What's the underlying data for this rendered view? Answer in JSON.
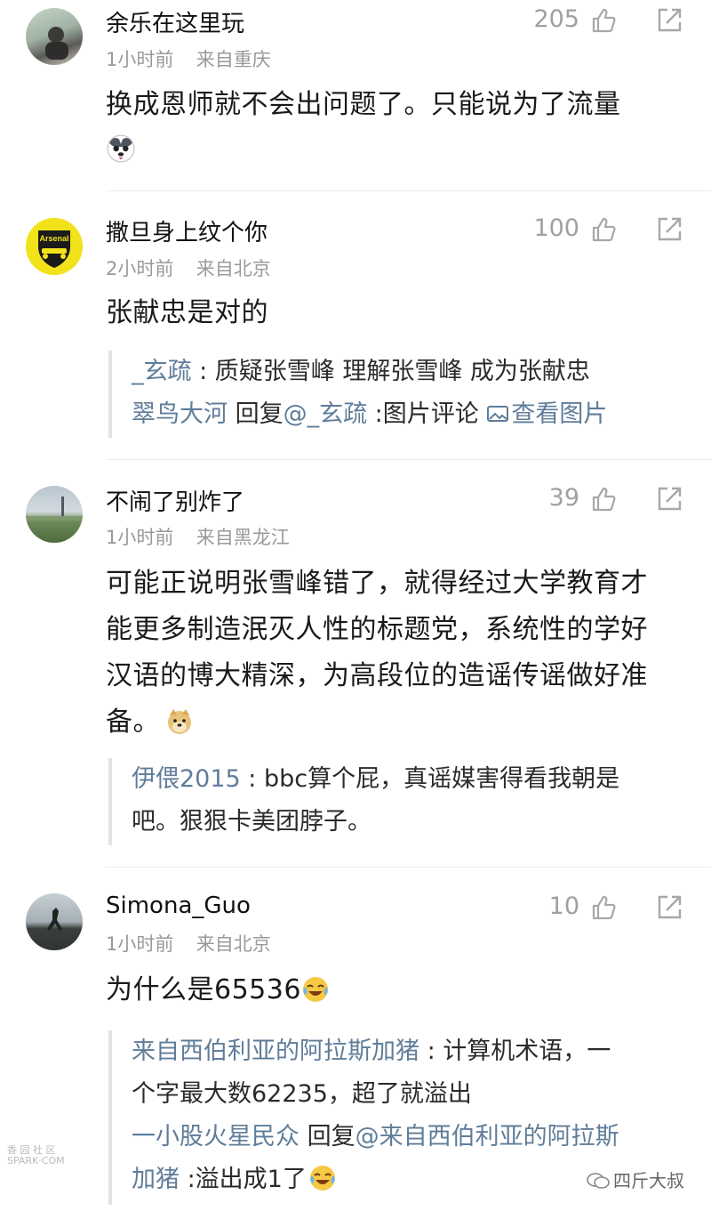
{
  "comments": [
    {
      "username": "余乐在这里玩",
      "time": "1小时前",
      "location": "来自重庆",
      "likes": "205",
      "text": "换成恩师就不会出问题了。只能说为了流量"
    },
    {
      "username": "撒旦身上纹个你",
      "avatar_label": "Arsenal",
      "time": "2小时前",
      "location": "来自北京",
      "likes": "100",
      "text": "张献忠是对的",
      "replies": [
        {
          "author": "_玄疏",
          "sep": " : ",
          "text": "质疑张雪峰 理解张雪峰 成为张献忠"
        },
        {
          "author": "翠鸟大河",
          "middle": " 回复",
          "mention": "@_玄疏",
          "text": " :图片评论 ",
          "link": "查看图片"
        }
      ]
    },
    {
      "username": "不闹了别炸了",
      "time": "1小时前",
      "location": "来自黑龙江",
      "likes": "39",
      "text_lines": [
        "可能正说明张雪峰错了，就得经过大学教育才",
        "能更多制造泯灭人性的标题党，系统性的学好",
        "汉语的博大精深，为高段位的造谣传谣做好准",
        "备。"
      ],
      "replies": [
        {
          "author": "伊偎2015",
          "sep": " : ",
          "text": "bbc算个屁，真谣媒害得看我朝是",
          "text2": "吧。狠狠卡美团脖子。"
        }
      ]
    },
    {
      "username": "Simona_Guo",
      "time": "1小时前",
      "location": "来自北京",
      "likes": "10",
      "text": "为什么是65536",
      "replies": [
        {
          "author": "来自西伯利亚的阿拉斯加猪",
          "sep": " : ",
          "text": "计算机术语，一",
          "text2": "个字最大数62235，超了就溢出"
        },
        {
          "author": "一小股火星民众",
          "middle": " 回复",
          "mention": "@来自西伯利亚的阿拉斯",
          "mention2": "加猪",
          "text": " :溢出成1了"
        }
      ]
    }
  ],
  "watermarks": {
    "left_line1": "香 园 社 区",
    "left_line2": "SPARK·COM",
    "right": "四斤大叔"
  },
  "colors": {
    "reply_name": "#5f7d99",
    "meta": "#9a9a9a",
    "likes": "#a0a0a0"
  }
}
